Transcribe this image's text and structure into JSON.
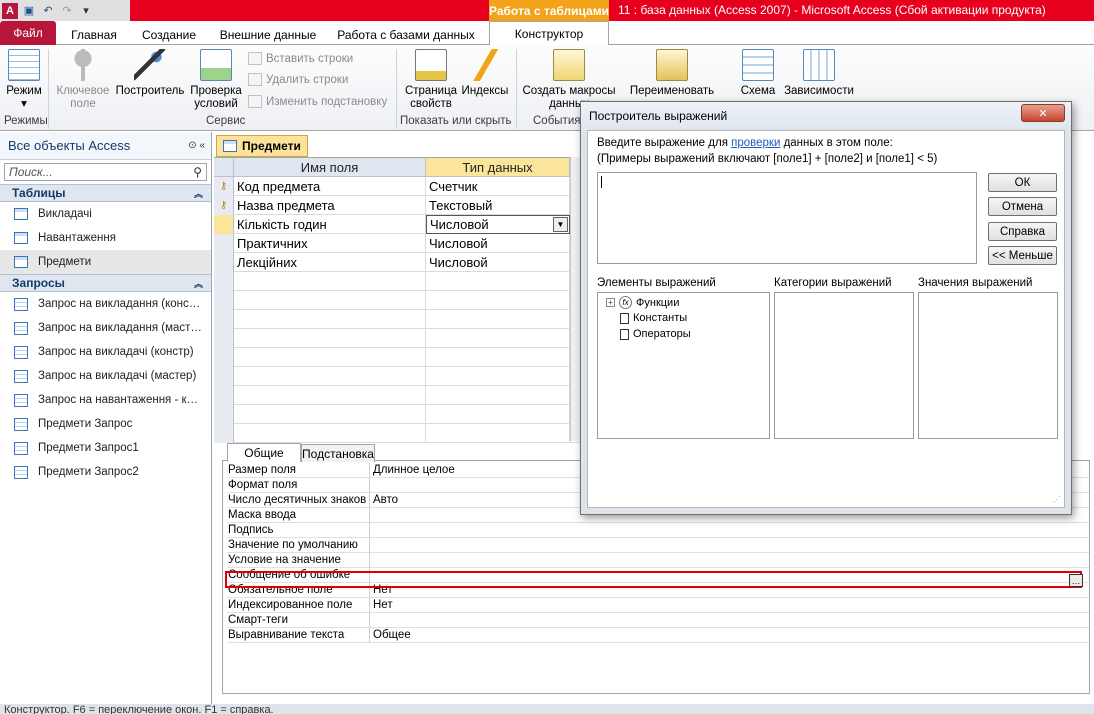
{
  "window": {
    "title": "11 : база данных (Access 2007)  -  Microsoft Access (Сбой активации продукта)",
    "context_tab": "Работа с таблицами"
  },
  "ribbon_tabs": [
    "Файл",
    "Главная",
    "Создание",
    "Внешние данные",
    "Работа с базами данных",
    "Конструктор"
  ],
  "ribbon": {
    "mode_label": "Режим",
    "key_field_label": "Ключевое поле",
    "builder_label": "Построитель",
    "check_label": "Проверка условий",
    "insert_rows": "Вставить строки",
    "delete_rows": "Удалить строки",
    "change_lookup": "Изменить подстановку",
    "property_sheet": "Страница свойств",
    "indexes": "Индексы",
    "create_macros": "Создать макросы данных",
    "rename": "Переименовать",
    "schema": "Схема",
    "dependencies": "Зависимости",
    "groups": {
      "modes": "Режимы",
      "service": "Сервис",
      "show_hide": "Показать или скрыть",
      "events": "События"
    }
  },
  "nav": {
    "header": "Все объекты Access",
    "search_placeholder": "Поиск...",
    "tables_section": "Таблицы",
    "tables": [
      "Викладачі",
      "Навантаження",
      "Предмети"
    ],
    "queries_section": "Запросы",
    "queries": [
      "Запрос на викладання (конс…",
      "Запрос на викладання (маст…",
      "Запрос на викладачі (констр)",
      "Запрос на викладачі (мастер)",
      "Запрос на навантаження - к…",
      "Предмети Запрос",
      "Предмети Запрос1",
      "Предмети Запрос2"
    ]
  },
  "document": {
    "tab_label": "Предмети",
    "col_field": "Имя поля",
    "col_type": "Тип данных",
    "rows": [
      {
        "name": "Код предмета",
        "type": "Счетчик"
      },
      {
        "name": "Назва предмета",
        "type": "Текстовый"
      },
      {
        "name": "Кількість годин",
        "type": "Числовой"
      },
      {
        "name": "Практичних",
        "type": "Числовой"
      },
      {
        "name": "Лекційних",
        "type": "Числовой"
      }
    ]
  },
  "properties": {
    "tab_general": "Общие",
    "tab_lookup": "Подстановка",
    "rows": [
      {
        "name": "Размер поля",
        "value": "Длинное целое"
      },
      {
        "name": "Формат поля",
        "value": ""
      },
      {
        "name": "Число десятичных знаков",
        "value": "Авто"
      },
      {
        "name": "Маска ввода",
        "value": ""
      },
      {
        "name": "Подпись",
        "value": ""
      },
      {
        "name": "Значение по умолчанию",
        "value": ""
      },
      {
        "name": "Условие на значение",
        "value": ""
      },
      {
        "name": "Сообщение об ошибке",
        "value": ""
      },
      {
        "name": "Обязательное поле",
        "value": "Нет"
      },
      {
        "name": "Индексированное поле",
        "value": "Нет"
      },
      {
        "name": "Смарт-теги",
        "value": ""
      },
      {
        "name": "Выравнивание текста",
        "value": "Общее"
      }
    ]
  },
  "dialog": {
    "title": "Построитель выражений",
    "prompt_before": "Введите выражение для ",
    "prompt_link": "проверки",
    "prompt_after": " данных в этом поле:",
    "examples": "(Примеры выражений включают [поле1] + [поле2] и [поле1] < 5)",
    "ok": "ОК",
    "cancel": "Отмена",
    "help": "Справка",
    "less": "<< Меньше",
    "elements_label": "Элементы выражений",
    "categories_label": "Категории выражений",
    "values_label": "Значения выражений",
    "tree": [
      "Функции",
      "Константы",
      "Операторы"
    ]
  },
  "status": "Конструктор.  F6 = переключение окон.  F1 = справка."
}
